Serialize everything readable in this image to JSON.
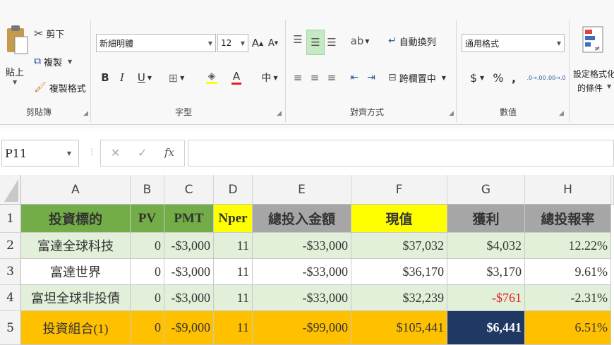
{
  "ribbon": {
    "clipboard": {
      "paste": "貼上",
      "cut": "剪下",
      "copy": "複製",
      "format_painter": "複製格式",
      "group": "剪貼簿"
    },
    "font": {
      "name": "新細明體",
      "size": "12",
      "grow": "A",
      "shrink": "A",
      "bold": "B",
      "italic": "I",
      "underline": "U",
      "font_color": "A",
      "phonetic": "中",
      "group": "字型"
    },
    "alignment": {
      "wrap": "自動換列",
      "merge": "跨欄置中",
      "group": "對齊方式"
    },
    "number": {
      "format": "通用格式",
      "currency": "$",
      "percent": "%",
      "comma": ",",
      "inc_decimal": ".0→.00",
      "dec_decimal": ".00→.0",
      "group": "數值"
    },
    "conditional": {
      "line1": "設定格式化",
      "line2": "的條件"
    }
  },
  "formula_bar": {
    "name_box": "P11",
    "cancel": "✕",
    "enter": "✓",
    "fx": "fx",
    "value": ""
  },
  "sheet": {
    "columns": [
      "A",
      "B",
      "C",
      "D",
      "E",
      "F",
      "G",
      "H"
    ],
    "rows": [
      "1",
      "2",
      "3",
      "4",
      "5"
    ],
    "header": [
      "投資標的",
      "PV",
      "PMT",
      "Nper",
      "總投入金額",
      "現值",
      "獲利",
      "總投報率"
    ],
    "data": [
      [
        "富達全球科技",
        "0",
        "-$3,000",
        "11",
        "-$33,000",
        "$37,032",
        "$4,032",
        "12.22%"
      ],
      [
        "富達世界",
        "0",
        "-$3,000",
        "11",
        "-$33,000",
        "$36,170",
        "$3,170",
        "9.61%"
      ],
      [
        "富坦全球非投債",
        "0",
        "-$3,000",
        "11",
        "-$33,000",
        "$32,239",
        "-$761",
        "-2.31%"
      ],
      [
        "投資組合(1)",
        "0",
        "-$9,000",
        "11",
        "-$99,000",
        "$105,441",
        "$6,441",
        "6.51%"
      ]
    ]
  },
  "colors": {
    "green_header": "#72ad47",
    "yellow": "#ffff00",
    "gray_header": "#a6a6a6",
    "light_green": "#e2efd9",
    "orange": "#ffc000",
    "blue": "#203864",
    "negative": "#e02020"
  }
}
